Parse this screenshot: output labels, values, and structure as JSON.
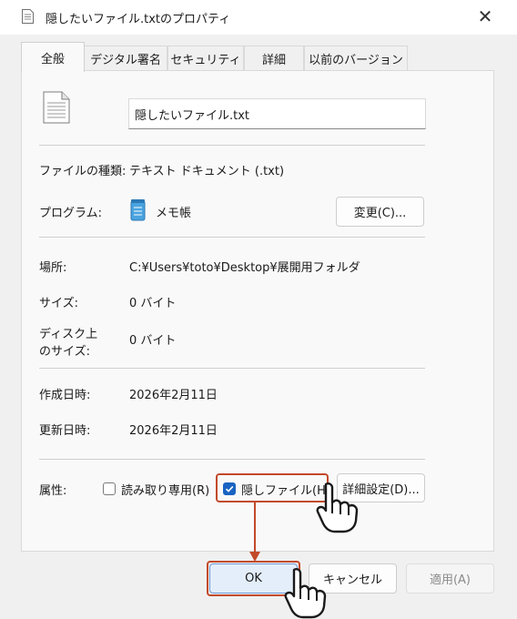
{
  "window": {
    "title": "隠したいファイル.txtのプロパティ",
    "close_glyph": "✕"
  },
  "tabs": [
    {
      "label": "全般",
      "active": true
    },
    {
      "label": "デジタル署名",
      "active": false
    },
    {
      "label": "セキュリティ",
      "active": false
    },
    {
      "label": "詳細",
      "active": false
    },
    {
      "label": "以前のバージョン",
      "active": false
    }
  ],
  "general": {
    "file_name": "隠したいファイル.txt",
    "file_type_label": "ファイルの種類:",
    "file_type_value": "テキスト ドキュメント (.txt)",
    "program_label": "プログラム:",
    "program_value": "メモ帳",
    "change_button": "変更(C)...",
    "location_label": "場所:",
    "location_value": "C:¥Users¥toto¥Desktop¥展開用フォルダ",
    "size_label": "サイズ:",
    "size_value": "0 バイト",
    "size_on_disk_label_line1": "ディスク上",
    "size_on_disk_label_line2": "のサイズ:",
    "size_on_disk_value": "0 バイト",
    "created_label": "作成日時:",
    "created_value": "2026年2月11日",
    "modified_label": "更新日時:",
    "modified_value": "2026年2月11日",
    "attributes_label": "属性:",
    "readonly_label": "読み取り専用(R)",
    "readonly_checked": false,
    "hidden_label": "隠しファイル(H)",
    "hidden_checked": true,
    "advanced_button": "詳細設定(D)..."
  },
  "footer": {
    "ok_button": "OK",
    "cancel_button": "キャンセル",
    "apply_button": "適用(A)",
    "apply_disabled": true
  },
  "colors": {
    "highlight": "#c24a2a",
    "checkbox_checked": "#1a63c2"
  },
  "icons": [
    "text-file-icon",
    "notepad-icon",
    "close-icon",
    "checkmark-icon",
    "pointing-hand-icon"
  ]
}
